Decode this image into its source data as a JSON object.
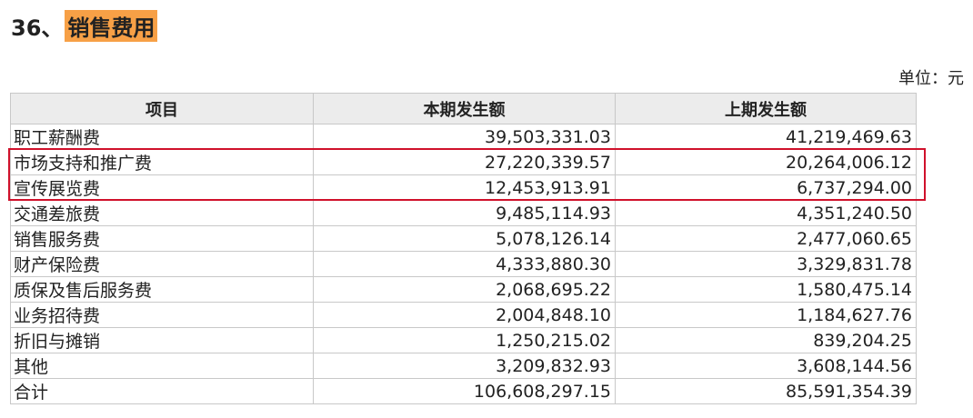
{
  "title": {
    "number": "36、",
    "text": "销售费用"
  },
  "unit": "单位：元",
  "table": {
    "headers": [
      "项目",
      "本期发生额",
      "上期发生额"
    ],
    "rows": [
      [
        "职工薪酬费",
        "39,503,331.03",
        "41,219,469.63"
      ],
      [
        "市场支持和推广费",
        "27,220,339.57",
        "20,264,006.12"
      ],
      [
        "宣传展览费",
        "12,453,913.91",
        "6,737,294.00"
      ],
      [
        "交通差旅费",
        "9,485,114.93",
        "4,351,240.50"
      ],
      [
        "销售服务费",
        "5,078,126.14",
        "2,477,060.65"
      ],
      [
        "财产保险费",
        "4,333,880.30",
        "3,329,831.78"
      ],
      [
        "质保及售后服务费",
        "2,068,695.22",
        "1,580,475.14"
      ],
      [
        "业务招待费",
        "2,004,848.10",
        "1,184,627.76"
      ],
      [
        "折旧与摊销",
        "1,250,215.02",
        "839,204.25"
      ],
      [
        "其他",
        "3,209,832.93",
        "3,608,144.56"
      ],
      [
        "合计",
        "106,608,297.15",
        "85,591,354.39"
      ]
    ]
  },
  "highlight_color": "#d0112b",
  "title_highlight_color": "#f7a046"
}
